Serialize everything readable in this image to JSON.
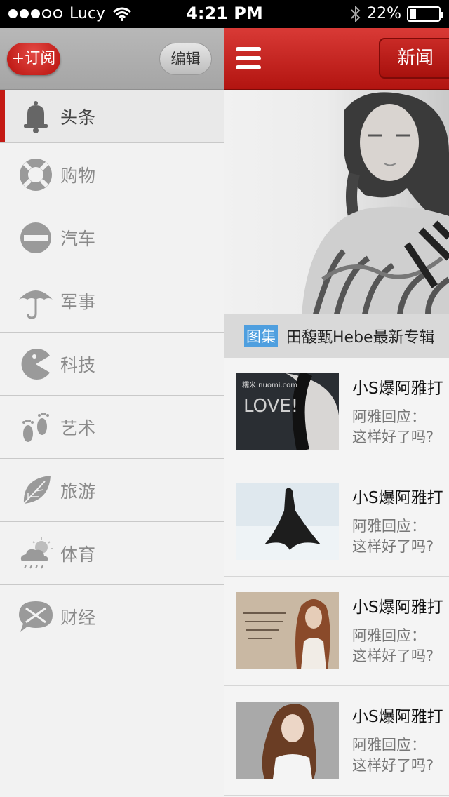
{
  "status": {
    "carrier": "Lucy",
    "time": "4:21 PM",
    "battery": "22%",
    "battery_level": 0.22
  },
  "sidebar": {
    "subscribe_label": "+订阅",
    "edit_label": "编辑",
    "items": [
      {
        "label": "头条",
        "icon": "bell-icon",
        "active": true
      },
      {
        "label": "购物",
        "icon": "lifebuoy-icon"
      },
      {
        "label": "汽车",
        "icon": "no-entry-icon"
      },
      {
        "label": "军事",
        "icon": "umbrella-icon"
      },
      {
        "label": "科技",
        "icon": "pacman-icon"
      },
      {
        "label": "艺术",
        "icon": "footprints-icon"
      },
      {
        "label": "旅游",
        "icon": "leaf-icon"
      },
      {
        "label": "体育",
        "icon": "weather-icon"
      },
      {
        "label": "财经",
        "icon": "envelope-icon"
      }
    ]
  },
  "main": {
    "news_label": "新闻",
    "featured": {
      "tag": "图集",
      "title": "田馥甄Hebe最新专辑"
    },
    "news": [
      {
        "title": "小S爆阿雅打",
        "line1": "阿雅回应：",
        "line2": "这样好了吗?"
      },
      {
        "title": "小S爆阿雅打",
        "line1": "阿雅回应：",
        "line2": "这样好了吗?"
      },
      {
        "title": "小S爆阿雅打",
        "line1": "阿雅回应：",
        "line2": "这样好了吗?"
      },
      {
        "title": "小S爆阿雅打",
        "line1": "阿雅回应：",
        "line2": "这样好了吗?"
      }
    ],
    "thumb_text": "LOVE!"
  },
  "colors": {
    "accent_red": "#c41a14",
    "tag_blue": "#4f9fdf"
  }
}
